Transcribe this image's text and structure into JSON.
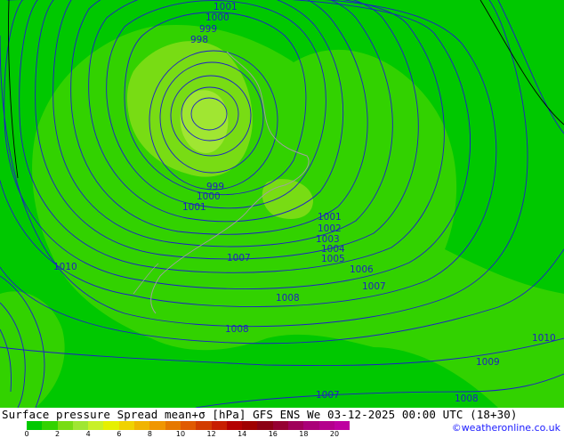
{
  "map": {
    "contour_labels": [
      {
        "text": "1001"
      },
      {
        "text": "1000"
      },
      {
        "text": "999"
      },
      {
        "text": "998"
      },
      {
        "text": "999"
      },
      {
        "text": "1000"
      },
      {
        "text": "1001"
      },
      {
        "text": "1001"
      },
      {
        "text": "1002"
      },
      {
        "text": "1003"
      },
      {
        "text": "1004"
      },
      {
        "text": "1005"
      },
      {
        "text": "1006"
      },
      {
        "text": "1007"
      },
      {
        "text": "1007"
      },
      {
        "text": "1008"
      },
      {
        "text": "1010"
      },
      {
        "text": "1008"
      },
      {
        "text": "1010"
      },
      {
        "text": "1009"
      },
      {
        "text": "1007"
      },
      {
        "text": "1008"
      }
    ],
    "fill_colors": {
      "base": "#00c800",
      "level2": "#32d200",
      "level4": "#78dc14",
      "level6": "#a0e632"
    },
    "contour_color": "#1e1ec8",
    "coast_color": "#a0a0a0"
  },
  "footer": {
    "title": "Surface pressure Spread mean+σ [hPa] GFS ENS  We 03-12-2025 00:00 UTC (18+30)",
    "credit": "©weatheronline.co.uk",
    "colorbar": {
      "colors": [
        "#00c800",
        "#32d200",
        "#78dc14",
        "#a0e632",
        "#c8f028",
        "#e6f000",
        "#f0d200",
        "#f0b400",
        "#f09600",
        "#e67800",
        "#e05a00",
        "#d23c00",
        "#c81e00",
        "#b40000",
        "#a00000",
        "#8c0014",
        "#960032",
        "#a0005a",
        "#aa0078",
        "#b4008c",
        "#be00a0"
      ],
      "tick_labels": [
        "0",
        "2",
        "4",
        "6",
        "8",
        "10",
        "12",
        "14",
        "16",
        "18",
        "20"
      ]
    }
  }
}
